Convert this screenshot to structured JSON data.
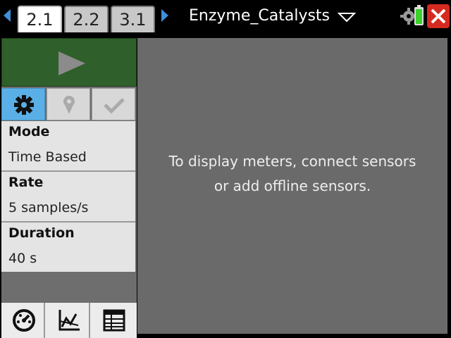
{
  "tabs": [
    {
      "label": "2.1",
      "active": true
    },
    {
      "label": "2.2",
      "active": false
    },
    {
      "label": "3.1",
      "active": false
    }
  ],
  "document": {
    "title": "Enzyme_Catalysts"
  },
  "icons": {
    "nav_left": "chevron-left-icon",
    "nav_right": "chevron-right-icon",
    "doc_menu": "triangle-down-icon",
    "battery": "battery-icon",
    "settings": "gear-icon",
    "close": "close-icon",
    "play": "play-icon",
    "marker": "map-pin-icon",
    "check": "check-icon",
    "meter": "meter-icon",
    "graph": "graph-icon",
    "table": "table-icon"
  },
  "settings_panel": {
    "mode_label": "Mode",
    "mode_value": "Time Based",
    "rate_label": "Rate",
    "rate_value": "5 samples/s",
    "duration_label": "Duration",
    "duration_value": "40 s"
  },
  "main": {
    "message_line1": "To display meters, connect sensors",
    "message_line2": "or add offline sensors."
  },
  "colors": {
    "accent_blue": "#3d8fd6",
    "start_green": "#2f5f2a",
    "active_tab_blue": "#5ab0e6",
    "close_red": "#d42a20",
    "battery_green": "#3ad12a"
  }
}
